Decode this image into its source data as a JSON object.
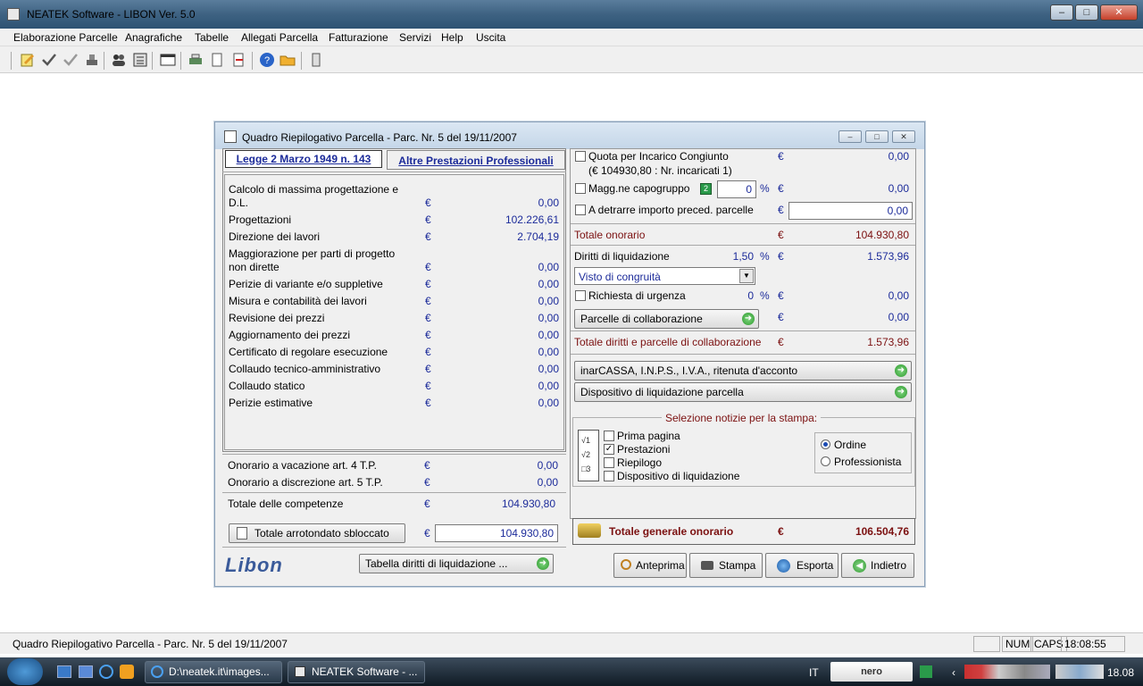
{
  "app": {
    "title": "NEATEK Software  -  LIBON Ver. 5.0"
  },
  "menu": [
    "Elaborazione Parcelle",
    "Anagrafiche",
    "Tabelle",
    "Allegati Parcella",
    "Fatturazione",
    "Servizi",
    "Help",
    "Uscita"
  ],
  "toolbar_icons": [
    "edit-icon",
    "check-icon",
    "check-gray-icon",
    "stamp-icon",
    "users-icon",
    "calc-icon",
    "window-icon",
    "printer-icon",
    "document-icon",
    "export-icon",
    "help-icon",
    "folder-icon",
    "book-icon"
  ],
  "dialog": {
    "title": "Quadro Riepilogativo Parcella - Parc. Nr. 5  del 19/11/2007",
    "tab1": "Legge 2 Marzo 1949 n. 143",
    "tab2": "Altre Prestazioni Professionali",
    "currency": "€",
    "left_rows": [
      {
        "label1": "Calcolo di massima progettazione e",
        "label2": "D.L.",
        "value": "0,00"
      },
      {
        "label1": "Progettazioni",
        "value": "102.226,61"
      },
      {
        "label1": "Direzione dei lavori",
        "value": "2.704,19"
      },
      {
        "label1": "Maggiorazione per parti di progetto",
        "label2": "non dirette",
        "value": "0,00"
      },
      {
        "label1": "Perizie di variante e/o suppletive",
        "value": "0,00"
      },
      {
        "label1": "Misura e contabilità dei lavori",
        "value": "0,00"
      },
      {
        "label1": "Revisione dei prezzi",
        "value": "0,00"
      },
      {
        "label1": "Aggiornamento dei prezzi",
        "value": "0,00"
      },
      {
        "label1": "Certificato di regolare esecuzione",
        "value": "0,00"
      },
      {
        "label1": "Collaudo tecnico-amministrativo",
        "value": "0,00"
      },
      {
        "label1": "Collaudo statico",
        "value": "0,00"
      },
      {
        "label1": "Perizie estimative",
        "value": "0,00"
      }
    ],
    "vacazione_label": "Onorario a vacazione art. 4 T.P.",
    "vacazione_value": "0,00",
    "discrezione_label": "Onorario a discrezione art. 5 T.P.",
    "discrezione_value": "0,00",
    "totale_competenze_label": "Totale delle competenze",
    "totale_competenze_value": "104.930,80",
    "arrotondato_button": "Totale arrotondato sbloccato",
    "arrotondato_value": "104.930,80",
    "logo": "Libon",
    "tabella_button": "Tabella diritti di liquidazione ...",
    "quota_label": "Quota per Incarico Congiunto",
    "quota_sub": "(€ 104930,80 : Nr. incaricati 1)",
    "quota_value": "0,00",
    "magg_label": "Magg.ne capogruppo",
    "magg_pct": "0",
    "magg_value": "0,00",
    "detrarre_label": "A detrarre importo preced. parcelle",
    "detrarre_value": "0,00",
    "totale_onorario_label": "Totale onorario",
    "totale_onorario_value": "104.930,80",
    "diritti_label": "Diritti di liquidazione",
    "diritti_pct": "1,50",
    "diritti_value": "1.573,96",
    "visto_select": "Visto di congruità",
    "urgenza_label": "Richiesta di urgenza",
    "urgenza_pct": "0",
    "urgenza_value": "0,00",
    "collab_button": "Parcelle di collaborazione",
    "collab_value": "0,00",
    "totale_diritti_label": "Totale diritti e parcelle di collaborazione",
    "totale_diritti_value": "1.573,96",
    "inarcassa_button": "inarCASSA, I.N.P.S., I.V.A., ritenuta d'acconto",
    "dispositivo_button": "Dispositivo di liquidazione parcella",
    "stampa_legend": "Selezione notizie per la stampa:",
    "stampa_options": [
      {
        "label": "Prima pagina",
        "checked": false
      },
      {
        "label": "Prestazioni",
        "checked": true
      },
      {
        "label": "Riepilogo",
        "checked": false
      },
      {
        "label": "Dispositivo di liquidazione",
        "checked": false
      }
    ],
    "ordine_label": "Ordine",
    "professionista_label": "Professionista",
    "totale_generale_label": "Totale generale onorario",
    "totale_generale_value": "106.504,76",
    "anteprima_button": "Anteprima",
    "stampa_button": "Stampa",
    "esporta_button": "Esporta",
    "indietro_button": "Indietro",
    "percent": "%"
  },
  "status": {
    "text": "Quadro Riepilogativo Parcella - Parc. Nr. 5  del 19/11/2007",
    "num": "NUM",
    "caps": "CAPS",
    "time": "18:08:55"
  },
  "taskbar": {
    "task1": "D:\\neatek.it\\images...",
    "task2": "NEATEK Software  - ...",
    "lang": "IT",
    "nero": "nero",
    "clock": "18.08"
  }
}
